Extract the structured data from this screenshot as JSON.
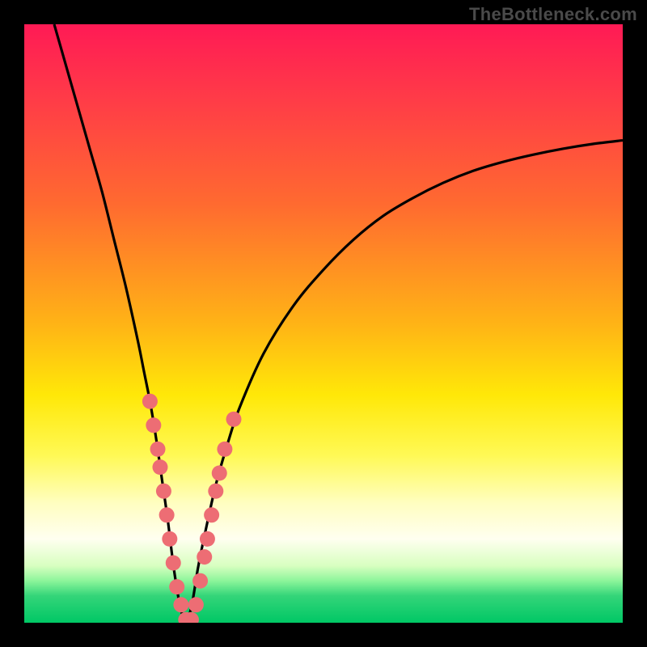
{
  "watermark": "TheBottleneck.com",
  "chart_data": {
    "type": "line",
    "title": "",
    "xlabel": "",
    "ylabel": "",
    "xlim": [
      0,
      100
    ],
    "ylim": [
      0,
      100
    ],
    "grid": false,
    "legend": false,
    "background_gradient": {
      "stops": [
        {
          "pos": 0.0,
          "color": "#ff1a55"
        },
        {
          "pos": 0.12,
          "color": "#ff3a48"
        },
        {
          "pos": 0.3,
          "color": "#ff6a30"
        },
        {
          "pos": 0.5,
          "color": "#ffb316"
        },
        {
          "pos": 0.62,
          "color": "#ffe808"
        },
        {
          "pos": 0.72,
          "color": "#fff955"
        },
        {
          "pos": 0.8,
          "color": "#fffec0"
        },
        {
          "pos": 0.86,
          "color": "#fffff0"
        },
        {
          "pos": 0.905,
          "color": "#d8ffc0"
        },
        {
          "pos": 0.93,
          "color": "#8cf59a"
        },
        {
          "pos": 0.955,
          "color": "#34d579"
        },
        {
          "pos": 1.0,
          "color": "#00c765"
        }
      ]
    },
    "series": [
      {
        "name": "bottleneck-curve",
        "color": "#000000",
        "x": [
          5,
          7,
          9,
          11,
          13,
          15,
          17,
          19,
          20,
          21,
          22,
          23,
          24,
          25,
          26,
          27,
          28,
          29,
          30,
          32,
          34,
          36,
          40,
          45,
          50,
          55,
          60,
          65,
          70,
          75,
          80,
          85,
          90,
          95,
          100
        ],
        "y": [
          100,
          93,
          86,
          79,
          72,
          64,
          56,
          47,
          42,
          37,
          31,
          24,
          17,
          9,
          3,
          0,
          3,
          9,
          14,
          23,
          30,
          36,
          45,
          53,
          59,
          64,
          68,
          71,
          73.5,
          75.5,
          77,
          78.2,
          79.2,
          80,
          80.6
        ]
      }
    ],
    "scatter": {
      "name": "data-points",
      "color": "#ed6d74",
      "points": [
        {
          "x": 21.0,
          "y": 37
        },
        {
          "x": 21.6,
          "y": 33
        },
        {
          "x": 22.3,
          "y": 29
        },
        {
          "x": 22.7,
          "y": 26
        },
        {
          "x": 23.3,
          "y": 22
        },
        {
          "x": 23.8,
          "y": 18
        },
        {
          "x": 24.3,
          "y": 14
        },
        {
          "x": 24.9,
          "y": 10
        },
        {
          "x": 25.5,
          "y": 6
        },
        {
          "x": 26.2,
          "y": 3
        },
        {
          "x": 27.0,
          "y": 0.5
        },
        {
          "x": 27.9,
          "y": 0.5
        },
        {
          "x": 28.7,
          "y": 3
        },
        {
          "x": 29.4,
          "y": 7
        },
        {
          "x": 30.1,
          "y": 11
        },
        {
          "x": 30.6,
          "y": 14
        },
        {
          "x": 31.3,
          "y": 18
        },
        {
          "x": 32.0,
          "y": 22
        },
        {
          "x": 32.6,
          "y": 25
        },
        {
          "x": 33.5,
          "y": 29
        },
        {
          "x": 35.0,
          "y": 34
        }
      ]
    }
  }
}
